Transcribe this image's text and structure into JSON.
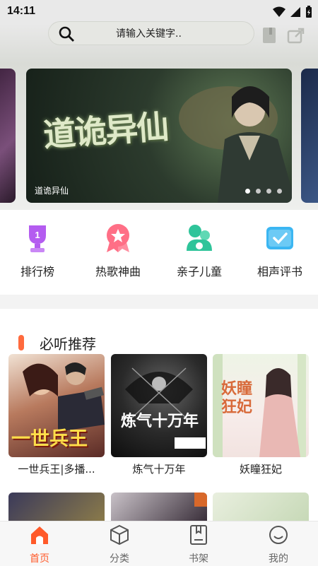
{
  "status": {
    "time": "14:11"
  },
  "search": {
    "placeholder": "请输入关键字.."
  },
  "banner": {
    "title_art": "道诡异仙",
    "caption": "道诡异仙",
    "dots_total": 4,
    "dots_active_index": 0
  },
  "quick_links": [
    {
      "label": "排行榜",
      "icon": "trophy-icon",
      "color": "#b45cf0"
    },
    {
      "label": "热歌神曲",
      "icon": "star-badge-icon",
      "color": "#ff6f86"
    },
    {
      "label": "亲子儿童",
      "icon": "parent-child-icon",
      "color": "#2fc49a"
    },
    {
      "label": "相声评书",
      "icon": "book-check-icon",
      "color": "#3bb6f2"
    }
  ],
  "section": {
    "title": "必听推荐",
    "books": [
      {
        "title": "一世兵王|多播...",
        "cover_text": "一世兵王"
      },
      {
        "title": "炼气十万年",
        "cover_text": "炼气十万年"
      },
      {
        "title": "妖瞳狂妃",
        "cover_text": "妖瞳狂妃"
      }
    ]
  },
  "nav": {
    "items": [
      {
        "label": "首页",
        "icon": "home-icon",
        "active": true
      },
      {
        "label": "分类",
        "icon": "cube-icon",
        "active": false
      },
      {
        "label": "书架",
        "icon": "bookshelf-icon",
        "active": false
      },
      {
        "label": "我的",
        "icon": "profile-icon",
        "active": false
      }
    ],
    "active_color": "#ff5a2a"
  }
}
